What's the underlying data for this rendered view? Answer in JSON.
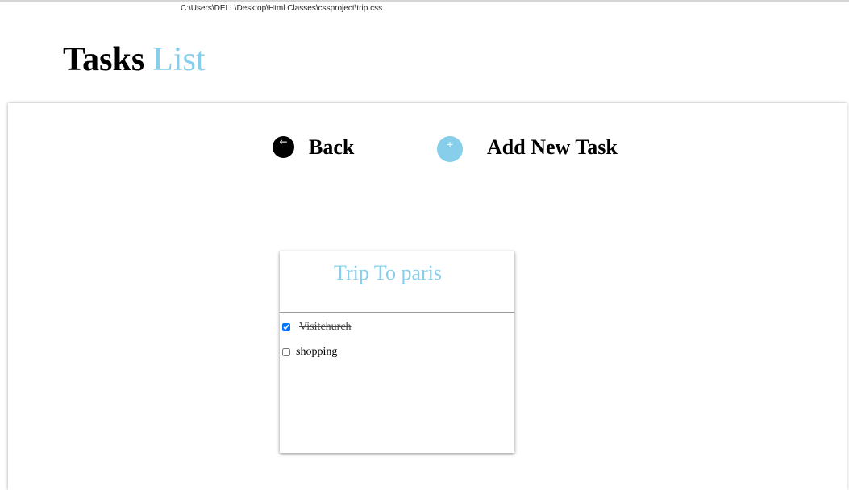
{
  "file_path": "C:\\Users\\DELL\\Desktop\\Html Classes\\cssproject\\trip.css",
  "heading": {
    "primary": "Tasks",
    "secondary": "List"
  },
  "toolbar": {
    "back_icon": "←",
    "back_label": "Back",
    "add_icon": "+",
    "add_label": "Add New Task"
  },
  "card": {
    "title": "Trip To paris",
    "tasks": [
      {
        "label": "Visitchurch",
        "checked": true
      },
      {
        "label": "shopping",
        "checked": false
      }
    ]
  },
  "colors": {
    "accent": "#87ceeb",
    "text": "#000000"
  },
  "icons": {
    "back": "arrow-left-icon",
    "add": "plus-icon"
  }
}
